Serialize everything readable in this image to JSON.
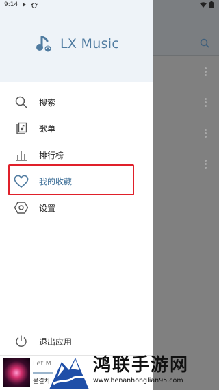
{
  "status_bar": {
    "time": "9:14",
    "icons": [
      "play-icon",
      "bug-icon",
      "wifi-icon",
      "battery-icon"
    ]
  },
  "drawer": {
    "app_name": "LX Music",
    "menu": [
      {
        "label": "搜索",
        "icon": "search-icon"
      },
      {
        "label": "歌单",
        "icon": "playlist-icon"
      },
      {
        "label": "排行榜",
        "icon": "chart-icon"
      },
      {
        "label": "我的收藏",
        "icon": "heart-icon",
        "active": true
      },
      {
        "label": "设置",
        "icon": "settings-icon"
      }
    ],
    "exit_label": "退出应用"
  },
  "player": {
    "song": "Let M",
    "artist": "물결치"
  },
  "watermark": {
    "title": "鸿联手游网",
    "url": "www.henanhonglian95.com"
  },
  "colors": {
    "accent": "#4f7ba0",
    "highlight_border": "#e0202a",
    "header_bg": "#eef3f8"
  }
}
